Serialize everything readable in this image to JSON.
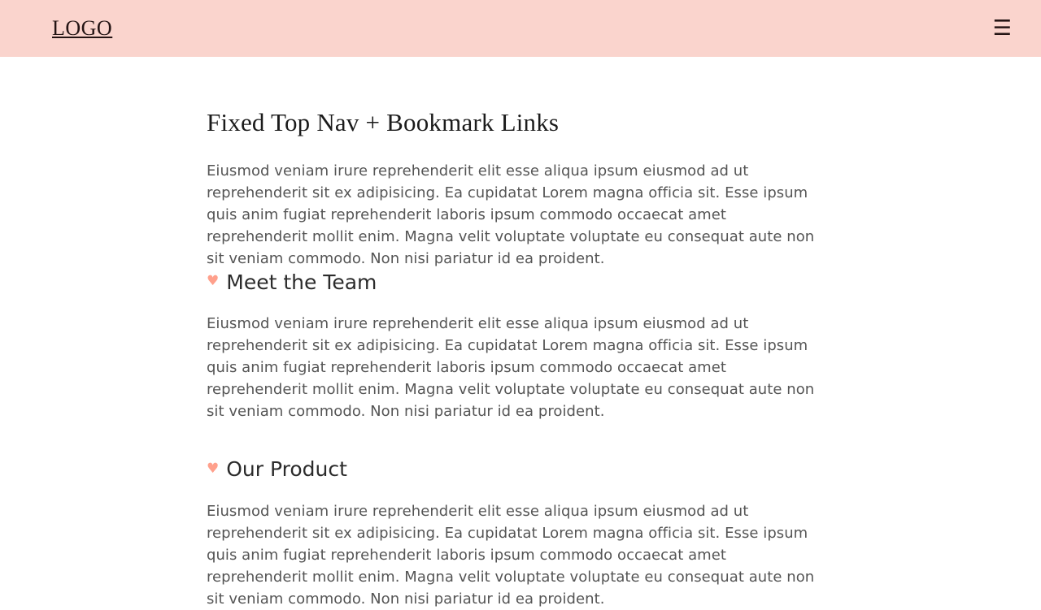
{
  "nav": {
    "logo": "LOGO",
    "menu_toggle_icon": "hamburger-menu-icon",
    "menu_toggle_glyph": "☰",
    "background_color": "#fad4cd",
    "text_color": "#241414"
  },
  "theme": {
    "accent_color": "#ffa08c",
    "page_background": "#ffffff",
    "heading_color": "#1b1b1b",
    "body_text_color": "#555555"
  },
  "main": {
    "title": "Fixed Top Nav + Bookmark Links",
    "intro_paragraph": "Eiusmod veniam irure reprehenderit elit esse aliqua ipsum eiusmod ad ut reprehenderit sit ex adipisicing. Ea cupidatat Lorem magna officia sit. Esse ipsum quis anim fugiat reprehenderit laboris ipsum commodo occaecat amet reprehenderit mollit enim. Magna velit voluptate voluptate eu consequat aute non sit veniam commodo. Non nisi pariatur id ea proident.",
    "sections": [
      {
        "icon": "heart-bookmark-icon",
        "icon_glyph": "♥",
        "heading": "Meet the Team",
        "paragraph": "Eiusmod veniam irure reprehenderit elit esse aliqua ipsum eiusmod ad ut reprehenderit sit ex adipisicing. Ea cupidatat Lorem magna officia sit. Esse ipsum quis anim fugiat reprehenderit laboris ipsum commodo occaecat amet reprehenderit mollit enim. Magna velit voluptate voluptate eu consequat aute non sit veniam commodo. Non nisi pariatur id ea proident."
      },
      {
        "icon": "heart-bookmark-icon",
        "icon_glyph": "♥",
        "heading": "Our Product",
        "paragraph": "Eiusmod veniam irure reprehenderit elit esse aliqua ipsum eiusmod ad ut reprehenderit sit ex adipisicing. Ea cupidatat Lorem magna officia sit. Esse ipsum quis anim fugiat reprehenderit laboris ipsum commodo occaecat amet reprehenderit mollit enim. Magna velit voluptate voluptate eu consequat aute non sit veniam commodo. Non nisi pariatur id ea proident."
      }
    ]
  }
}
